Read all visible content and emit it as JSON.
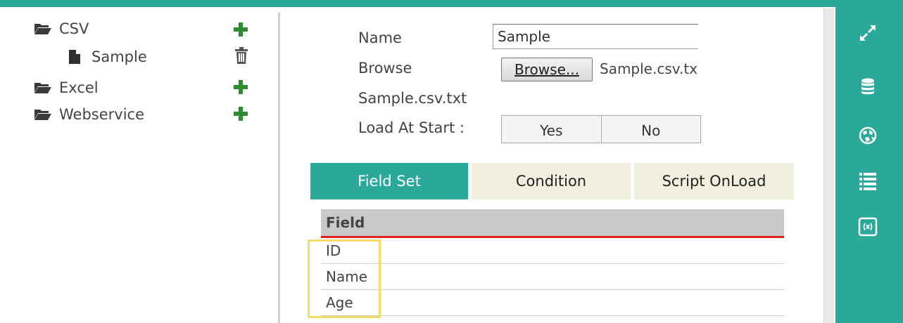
{
  "tree": {
    "items": [
      {
        "label": "CSV",
        "icon": "folder-icon",
        "action": "plus-icon"
      },
      {
        "label": "Sample",
        "icon": "file-icon",
        "action": "trash-icon"
      },
      {
        "label": "Excel",
        "icon": "folder-icon",
        "action": "plus-icon"
      },
      {
        "label": "Webservice",
        "icon": "folder-icon",
        "action": "plus-icon"
      }
    ]
  },
  "form": {
    "name_label": "Name",
    "name_value": "Sample",
    "browse_label": "Browse",
    "browse_button": "Browse...",
    "browse_filename": "Sample.csv.txt",
    "file_name_text": "Sample.csv.txt",
    "load_label": "Load At Start :",
    "load_yes": "Yes",
    "load_no": "No"
  },
  "tabs": {
    "field_set": "Field Set",
    "condition": "Condition",
    "script_onload": "Script OnLoad",
    "active": "Field Set"
  },
  "grid": {
    "header": "Field",
    "rows": [
      "ID",
      "Name",
      "Age"
    ]
  },
  "right_toolbar": {
    "icons": [
      "expand-icon",
      "database-icon",
      "globe-icon",
      "list-icon",
      "formula-icon"
    ]
  },
  "colors": {
    "accent": "#2aa89a",
    "plus": "#2e8b2e",
    "highlight": "#f2dc6a",
    "grid_header_underline": "#e02020"
  }
}
